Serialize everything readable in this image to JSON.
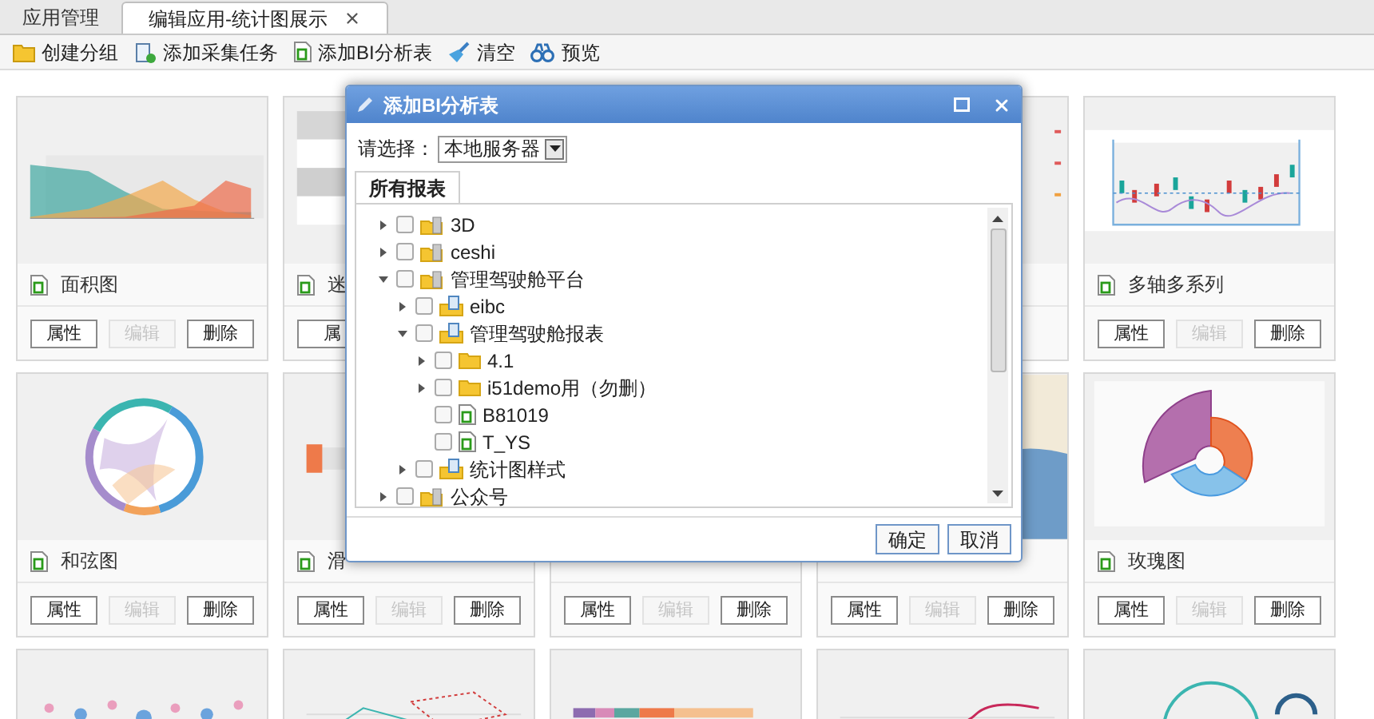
{
  "tabs": [
    {
      "label": "应用管理",
      "selected": false,
      "closable": false
    },
    {
      "label": "编辑应用-统计图展示",
      "selected": true,
      "closable": true
    }
  ],
  "toolbar": [
    {
      "kind": "folder",
      "label": "创建分组"
    },
    {
      "kind": "task",
      "label": "添加采集任务"
    },
    {
      "kind": "report",
      "label": "添加BI分析表"
    },
    {
      "kind": "broom",
      "label": "清空"
    },
    {
      "kind": "binoculars",
      "label": "预览"
    }
  ],
  "cards": [
    {
      "kind": "area",
      "name": "面积图",
      "buttons": [
        {
          "label": "属性",
          "disabled": false
        },
        {
          "label": "编辑",
          "disabled": true
        },
        {
          "label": "删除",
          "disabled": false
        }
      ]
    },
    {
      "kind": "table",
      "name": "迷",
      "buttons": [
        {
          "label": "属",
          "disabled": false
        }
      ]
    },
    {
      "kind": "legend"
    },
    {
      "kind": "candlestick",
      "name": "多轴多系列",
      "buttons": [
        {
          "label": "属性",
          "disabled": false
        },
        {
          "label": "编辑",
          "disabled": true
        },
        {
          "label": "删除",
          "disabled": false
        }
      ]
    },
    {
      "kind": "chord",
      "name": "和弦图",
      "buttons": [
        {
          "label": "属性",
          "disabled": false
        },
        {
          "label": "编辑",
          "disabled": true
        },
        {
          "label": "删除",
          "disabled": false
        }
      ]
    },
    {
      "kind": "slider",
      "name": "滑",
      "buttons": [
        {
          "label": "属性",
          "disabled": false
        },
        {
          "label": "编辑",
          "disabled": true
        },
        {
          "label": "删除",
          "disabled": false
        }
      ]
    },
    {
      "kind": "blank",
      "buttons": [
        {
          "label": "属性",
          "disabled": false
        },
        {
          "label": "编辑",
          "disabled": true
        },
        {
          "label": "删除",
          "disabled": false
        }
      ]
    },
    {
      "kind": "map",
      "buttons": [
        {
          "label": "属性",
          "disabled": false
        },
        {
          "label": "编辑",
          "disabled": true
        },
        {
          "label": "删除",
          "disabled": false
        }
      ]
    },
    {
      "kind": "rose",
      "name": "玫瑰图",
      "buttons": [
        {
          "label": "属性",
          "disabled": false
        },
        {
          "label": "编辑",
          "disabled": true
        },
        {
          "label": "删除",
          "disabled": false
        }
      ]
    },
    {
      "kind": "bubble"
    },
    {
      "kind": "scatter"
    },
    {
      "kind": "stacked-bar"
    },
    {
      "kind": "line"
    },
    {
      "kind": "gauge"
    }
  ],
  "dialog": {
    "title": "添加BI分析表",
    "select_label": "请选择：",
    "select_value": "本地服务器",
    "tab": "所有报表",
    "tree": [
      {
        "label": "3D",
        "kind": "group",
        "checked": false,
        "expanded": false
      },
      {
        "label": "ceshi",
        "kind": "group",
        "checked": false,
        "expanded": false
      },
      {
        "label": "管理驾驶舱平台",
        "kind": "group",
        "checked": false,
        "expanded": true,
        "children": [
          {
            "label": "eibc",
            "kind": "package",
            "checked": false,
            "expanded": false
          },
          {
            "label": "管理驾驶舱报表",
            "kind": "package",
            "checked": false,
            "expanded": true,
            "children": [
              {
                "label": "4.1",
                "kind": "folder",
                "checked": false,
                "expanded": false
              },
              {
                "label": "i51demo用（勿删）",
                "kind": "folder",
                "checked": false,
                "expanded": false
              },
              {
                "label": "B81019",
                "kind": "report",
                "checked": false
              },
              {
                "label": "T_YS",
                "kind": "report",
                "checked": false
              }
            ]
          },
          {
            "label": "统计图样式",
            "kind": "package",
            "checked": false,
            "expanded": false
          }
        ]
      },
      {
        "label": "公众号",
        "kind": "group",
        "checked": false,
        "expanded": false
      }
    ],
    "buttons": [
      "确定",
      "取消"
    ]
  }
}
